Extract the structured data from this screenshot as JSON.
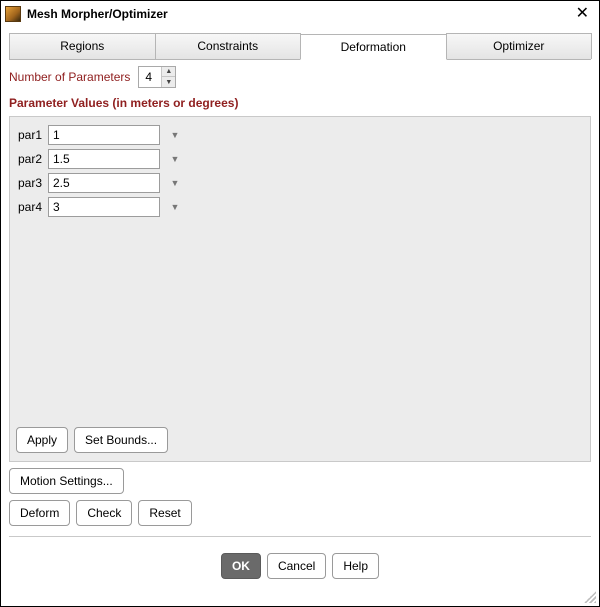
{
  "window": {
    "title": "Mesh Morpher/Optimizer"
  },
  "tabs": [
    {
      "label": "Regions",
      "active": false
    },
    {
      "label": "Constraints",
      "active": false
    },
    {
      "label": "Deformation",
      "active": true
    },
    {
      "label": "Optimizer",
      "active": false
    }
  ],
  "num_params": {
    "label": "Number of Parameters",
    "value": "4"
  },
  "section_title": "Parameter Values (in meters or degrees)",
  "parameters": [
    {
      "name": "par1",
      "value": "1"
    },
    {
      "name": "par2",
      "value": "1.5"
    },
    {
      "name": "par3",
      "value": "2.5"
    },
    {
      "name": "par4",
      "value": "3"
    }
  ],
  "panel_buttons": {
    "apply": "Apply",
    "set_bounds": "Set Bounds..."
  },
  "action_buttons": {
    "motion_settings": "Motion Settings...",
    "deform": "Deform",
    "check": "Check",
    "reset": "Reset"
  },
  "footer_buttons": {
    "ok": "OK",
    "cancel": "Cancel",
    "help": "Help"
  }
}
